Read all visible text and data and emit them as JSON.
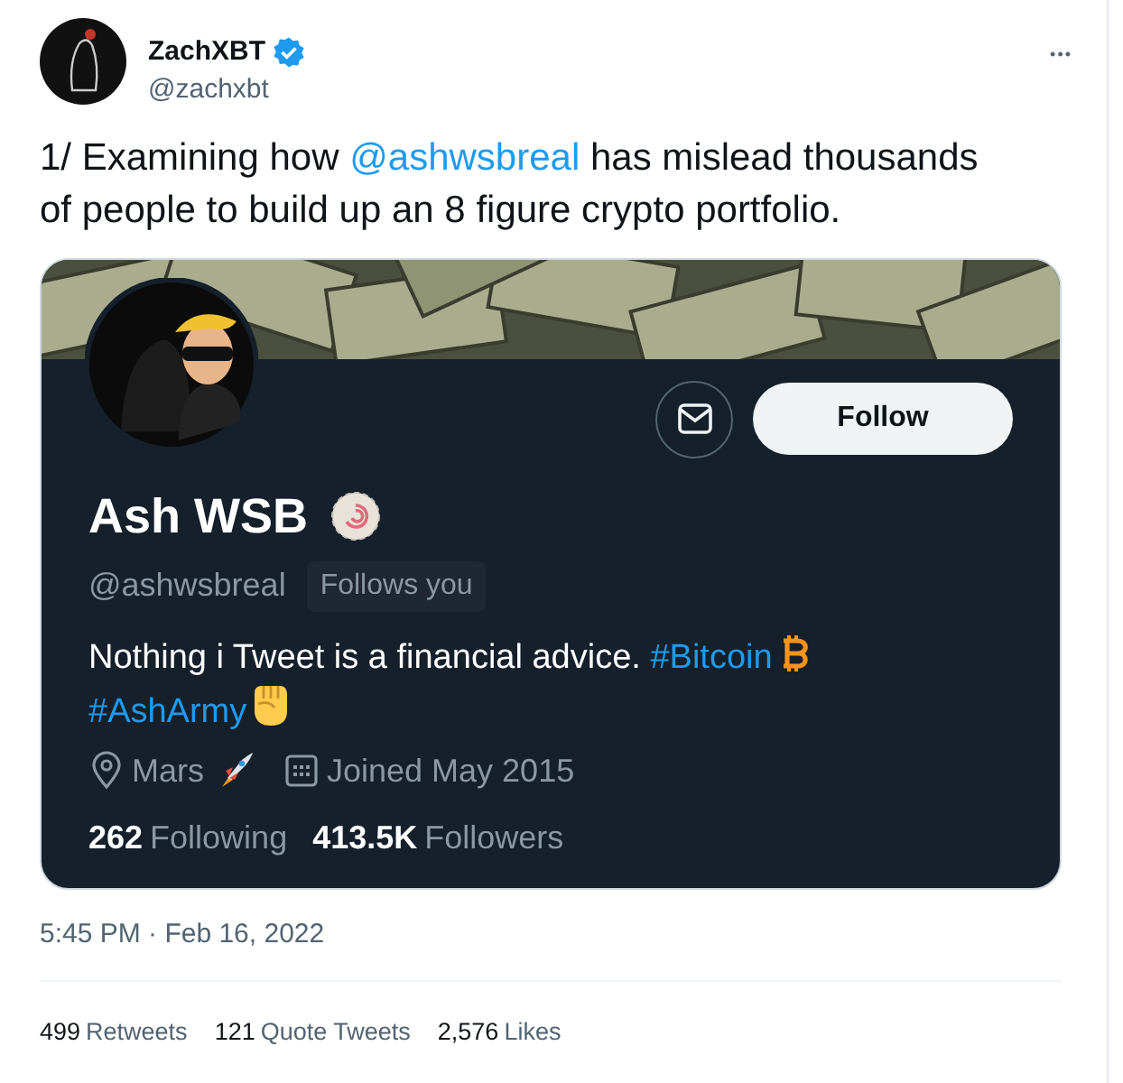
{
  "author": {
    "name": "ZachXBT",
    "verified": true,
    "handle": "@zachxbt"
  },
  "more_button": "•••",
  "tweet_text": [
    {
      "kind": "text",
      "text": "1/ Examining how "
    },
    {
      "kind": "mention",
      "text": "@ashwsbreal"
    },
    {
      "kind": "text",
      "text": " has mislead thousands of people to build up an 8 figure crypto portfolio."
    }
  ],
  "profile_card": {
    "name": "Ash WSB",
    "handle": "@ashwsbreal",
    "follows_you": "Follows you",
    "follow_button": "Follow",
    "bio": [
      {
        "kind": "text",
        "text": "Nothing i Tweet is a financial advice. "
      },
      {
        "kind": "hashtag",
        "text": "#Bitcoin"
      },
      {
        "kind": "bitcoin"
      },
      {
        "kind": "break"
      },
      {
        "kind": "hashtag",
        "text": "#AshArmy"
      },
      {
        "kind": "fist"
      }
    ],
    "location": "Mars",
    "joined": "Joined May 2015",
    "stats": [
      {
        "count": "262",
        "noun": "Following"
      },
      {
        "count": "413.5K",
        "noun": "Followers"
      }
    ]
  },
  "timestamp": "5:45 PM · Feb 16, 2022",
  "engagement": [
    {
      "count": "499",
      "noun": "Retweets"
    },
    {
      "count": "121",
      "noun": "Quote Tweets"
    },
    {
      "count": "2,576",
      "noun": "Likes"
    }
  ]
}
